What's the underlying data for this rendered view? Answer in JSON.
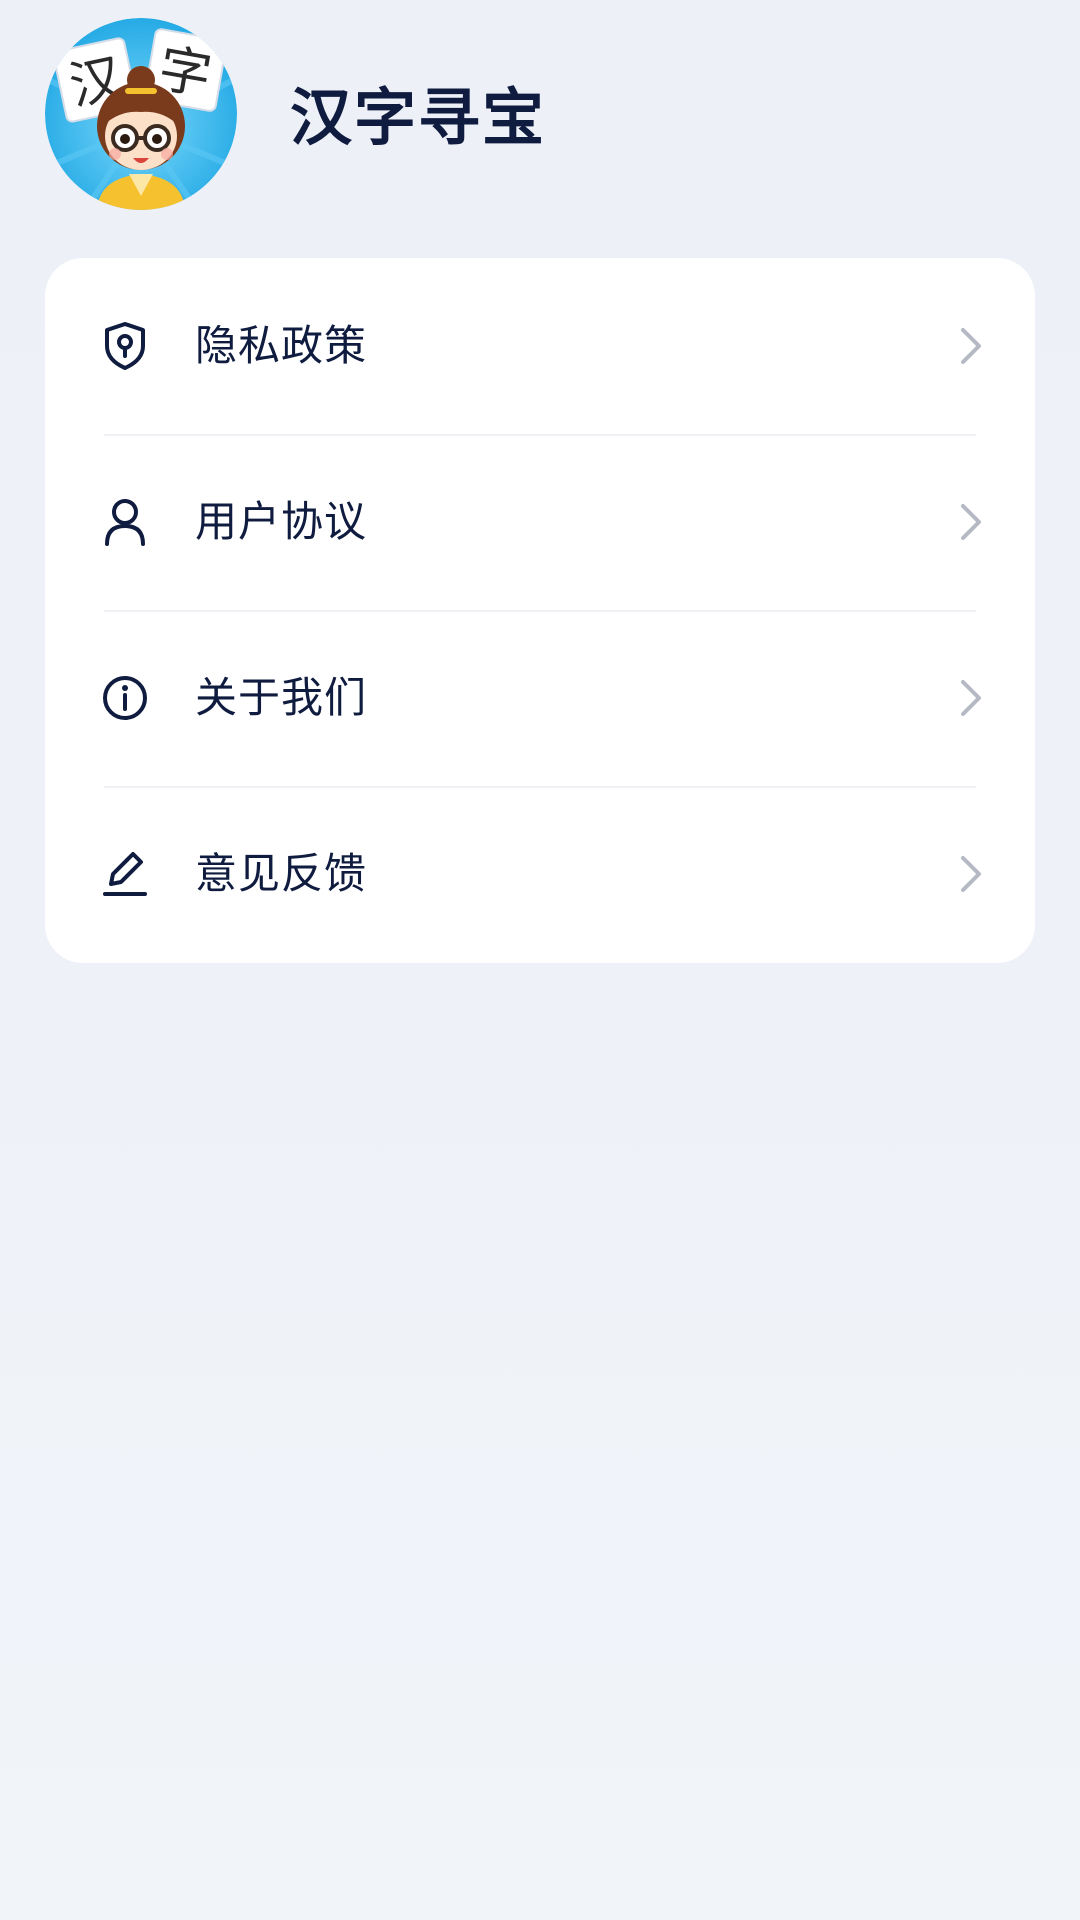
{
  "header": {
    "app_title": "汉字寻宝",
    "logo_text_left": "汉",
    "logo_text_right": "字"
  },
  "menu": {
    "items": [
      {
        "label": "隐私政策",
        "icon": "shield-keyhole-icon"
      },
      {
        "label": "用户协议",
        "icon": "user-icon"
      },
      {
        "label": "关于我们",
        "icon": "info-circle-icon"
      },
      {
        "label": "意见反馈",
        "icon": "pen-edit-icon"
      }
    ]
  },
  "colors": {
    "text_primary": "#0f1c3f",
    "chevron": "#b4b9c4",
    "card_bg": "#ffffff",
    "page_bg": "#eef2f8",
    "logo_blue": "#2bb3ec"
  }
}
